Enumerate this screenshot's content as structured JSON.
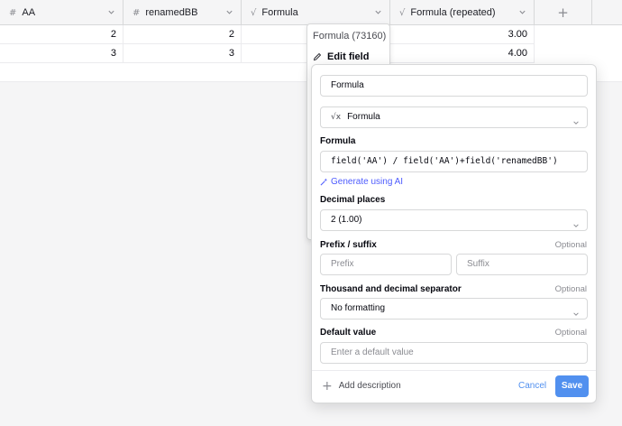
{
  "grid": {
    "columns": [
      {
        "icon": "#",
        "label": "AA"
      },
      {
        "icon": "#",
        "label": "renamedBB"
      },
      {
        "icon": "√",
        "label": "Formula"
      },
      {
        "icon": "√",
        "label": "Formula (repeated)"
      }
    ],
    "add_column": "+",
    "rows": [
      {
        "aa": "2",
        "bb": "2",
        "repeated": "3.00"
      },
      {
        "aa": "3",
        "bb": "3",
        "repeated": "4.00"
      }
    ]
  },
  "context_menu": {
    "title": "Formula (73160)",
    "edit_field": "Edit field"
  },
  "modal": {
    "field_name": "Formula",
    "field_type": "Formula",
    "type_icon": "√x",
    "formula_label": "Formula",
    "formula_value": "field('AA') / field('AA')+field('renamedBB')",
    "generate_ai": "Generate using AI",
    "decimal_label": "Decimal places",
    "decimal_value": "2 (1.00)",
    "prefix_suffix_label": "Prefix / suffix",
    "optional": "Optional",
    "prefix_placeholder": "Prefix",
    "suffix_placeholder": "Suffix",
    "separator_label": "Thousand and decimal separator",
    "separator_value": "No formatting",
    "default_label": "Default value",
    "default_placeholder": "Enter a default value",
    "add_description": "Add description",
    "cancel": "Cancel",
    "save": "Save"
  },
  "colors": {
    "accent": "#5190ef",
    "border": "#d7d8d9"
  }
}
